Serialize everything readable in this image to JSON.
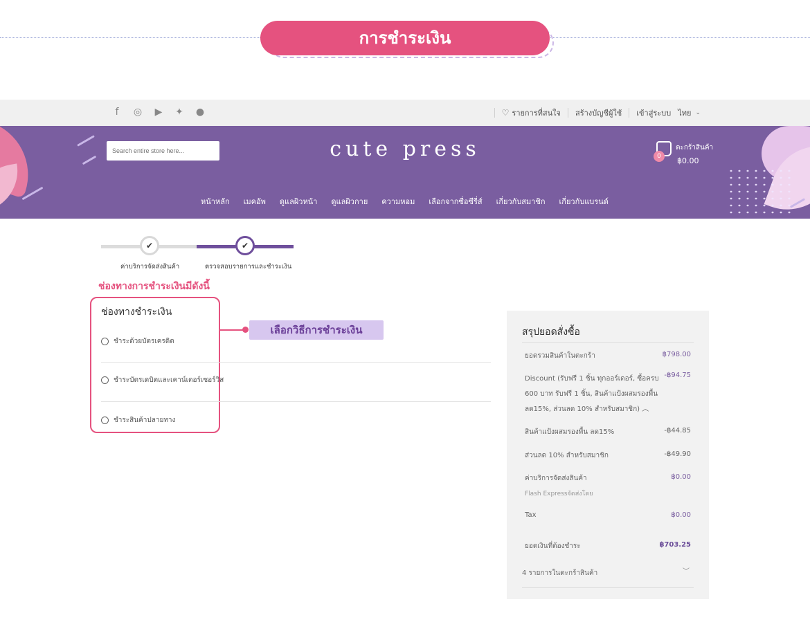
{
  "banner": {
    "title": "การชำระเงิน"
  },
  "topbar": {
    "social": [
      "facebook-icon",
      "instagram-icon",
      "youtube-icon",
      "twitter-icon",
      "line-icon"
    ],
    "wishlist": "รายการที่สนใจ",
    "create_account": "สร้างบัญชีผู้ใช้",
    "login": "เข้าสู่ระบบ",
    "language": "ไทย"
  },
  "header": {
    "search_placeholder": "Search entire store here...",
    "logo": "cute press",
    "cart_label": "ตะกร้าสินค้า",
    "cart_count": "0",
    "cart_total": "฿0.00",
    "nav": [
      "หน้าหลัก",
      "เมคอัพ",
      "ดูแลผิวหน้า",
      "ดูแลผิวกาย",
      "ความหอม",
      "เลือกจากซื่อซีรี่ส์",
      "เกี่ยวกับสมาชิก",
      "เกี่ยวกับแบรนด์"
    ]
  },
  "steps": {
    "step1": "ค่าบริการจัดส่งสินค้า",
    "step2": "ตรวจสอบรายการและชำระเงิน"
  },
  "payment": {
    "heading": "ช่องทางการชำระเงินมีดังนี้",
    "title": "ช่องทางชำระเงิน",
    "options": [
      "ชำระด้วยบัตรเครดิต",
      "ชำระบัตรเดบิตและเคาน์เตอร์เซอร์วิส",
      "ชำระสินค้าปลายทาง"
    ],
    "callout": "เลือกวิธีการชำระเงิน"
  },
  "summary": {
    "title": "สรุปยอดสั่งซื้อ",
    "subtotal_label": "ยอดรวมสินค้าในตะกร้า",
    "subtotal_value": "฿798.00",
    "discount_label": "Discount (รับฟรี 1 ชิ้น ทุกออร์เดอร์, ซื้อครบ 600 บาท รับฟรี 1 ชิ้น, สินค้าแป้งผสมรองพื้น ลด15%, ส่วนลด 10% สำหรับสมาชิก)",
    "discount_value": "-฿94.75",
    "powder_label": "สินค้าแป้งผสมรองพื้น ลด15%",
    "powder_value": "-฿44.85",
    "member_label": "ส่วนลด 10% สำหรับสมาชิก",
    "member_value": "-฿49.90",
    "shipping_label": "ค่าบริการจัดส่งสินค้า",
    "shipping_value": "฿0.00",
    "shipping_sub": "Flash Expressจัดส่งโดย",
    "tax_label": "Tax",
    "tax_value": "฿0.00",
    "total_label": "ยอดเงินที่ต้องชำระ",
    "total_value": "฿703.25",
    "items_label": "4 รายการในตะกร้าสินค้า"
  }
}
